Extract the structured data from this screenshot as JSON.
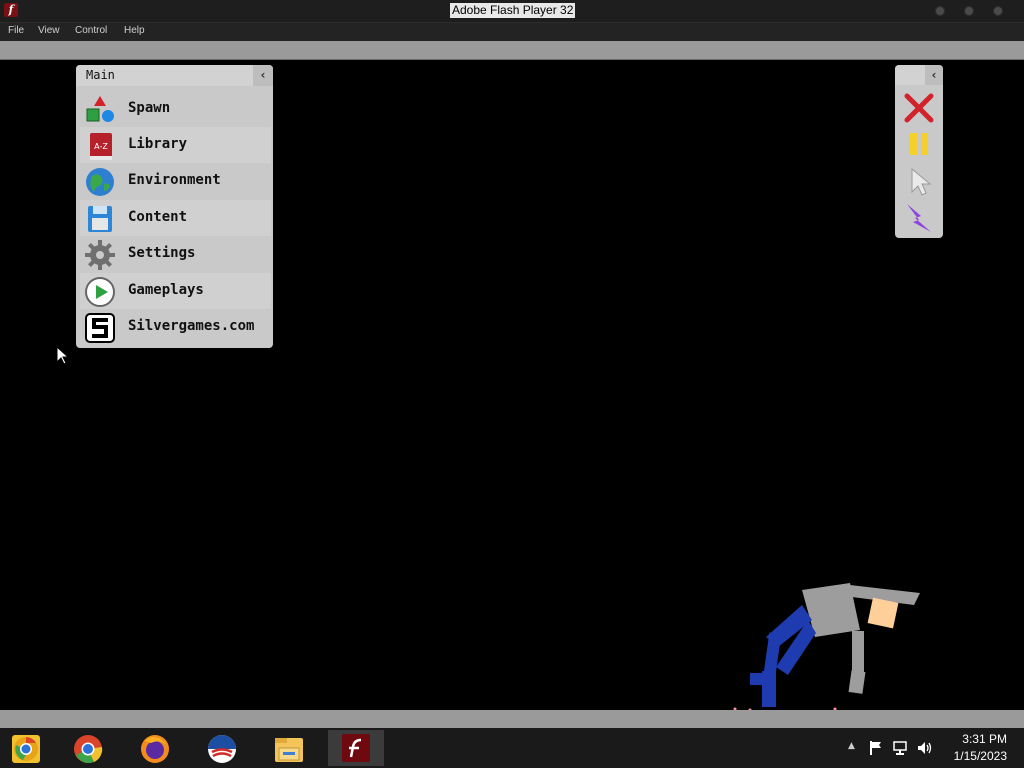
{
  "window": {
    "title": "Adobe Flash Player 32",
    "app_icon": "flash-icon",
    "buttons": [
      "minimize-icon",
      "maximize-icon",
      "close-icon"
    ]
  },
  "menubar": {
    "items": [
      "File",
      "View",
      "Control",
      "Help"
    ]
  },
  "main_panel": {
    "title": "Main",
    "collapse_icon": "chevron-left-icon",
    "items": [
      {
        "label": "Spawn",
        "icon": "shapes-icon"
      },
      {
        "label": "Library",
        "icon": "book-icon"
      },
      {
        "label": "Environment",
        "icon": "globe-icon"
      },
      {
        "label": "Content",
        "icon": "floppy-disk-icon"
      },
      {
        "label": "Settings",
        "icon": "gear-icon"
      },
      {
        "label": "Gameplays",
        "icon": "play-icon"
      },
      {
        "label": "Silvergames.com",
        "icon": "silvergames-logo-icon"
      }
    ]
  },
  "library_icon_text": "A-Z",
  "tool_panel": {
    "collapse_icon": "chevron-left-icon",
    "tools": [
      {
        "name": "delete",
        "icon": "red-x-icon"
      },
      {
        "name": "pause",
        "icon": "pause-icon"
      },
      {
        "name": "select",
        "icon": "cursor-icon"
      },
      {
        "name": "power",
        "icon": "lightning-icon"
      }
    ]
  },
  "taskbar": {
    "apps": [
      "chrome-canary-icon",
      "chrome-icon",
      "firefox-icon",
      "obama-logo-icon",
      "file-explorer-icon",
      "flash-player-icon"
    ],
    "time": "3:31 PM",
    "date": "1/15/2023"
  },
  "colors": {
    "panel_bg": "#c9c9c9",
    "ground": "#9a9a9a",
    "ragdoll_body": "#9d9d9d",
    "ragdoll_legs": "#1f3bb0",
    "ragdoll_head": "#ffcf9a"
  }
}
